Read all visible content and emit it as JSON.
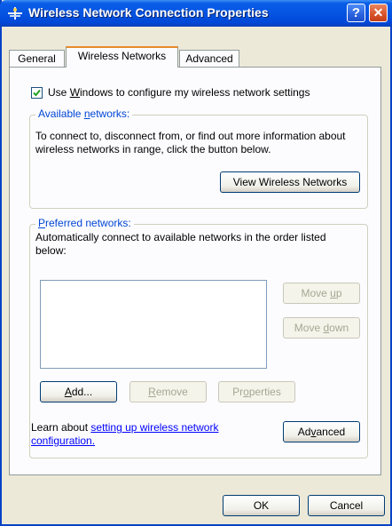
{
  "window": {
    "title": "Wireless Network Connection Properties",
    "help_glyph": "?",
    "close_glyph": "✕"
  },
  "tabs": [
    {
      "label": "General"
    },
    {
      "label": "Wireless Networks"
    },
    {
      "label": "Advanced"
    }
  ],
  "use_windows": {
    "checked": true,
    "label_pre": "Use ",
    "label_u": "W",
    "label_post": "indows to configure my wireless network settings"
  },
  "available": {
    "label_u": "n",
    "label_pre": "Available ",
    "label_post": "etworks:",
    "desc": "To connect to, disconnect from, or find out more information about wireless networks in range, click the button below.",
    "view_button": "View Wireless Networks"
  },
  "preferred": {
    "label_u": "P",
    "label_post": "referred networks:",
    "desc": "Automatically connect to available networks in the order listed below:",
    "move_up_pre": "Move ",
    "move_up_u": "u",
    "move_up_post": "p",
    "move_down_pre": "Move ",
    "move_down_u": "d",
    "move_down_post": "own",
    "add_u": "A",
    "add_post": "dd...",
    "remove_u": "R",
    "remove_post": "emove",
    "properties_pre": "Pr",
    "properties_u": "o",
    "properties_post": "perties"
  },
  "learn": {
    "pre": "Learn about ",
    "link1": "setting up wireless network",
    "link2": "configuration."
  },
  "advanced_button": {
    "pre": "Ad",
    "u": "v",
    "post": "anced"
  },
  "footer": {
    "ok": "OK",
    "cancel": "Cancel"
  }
}
